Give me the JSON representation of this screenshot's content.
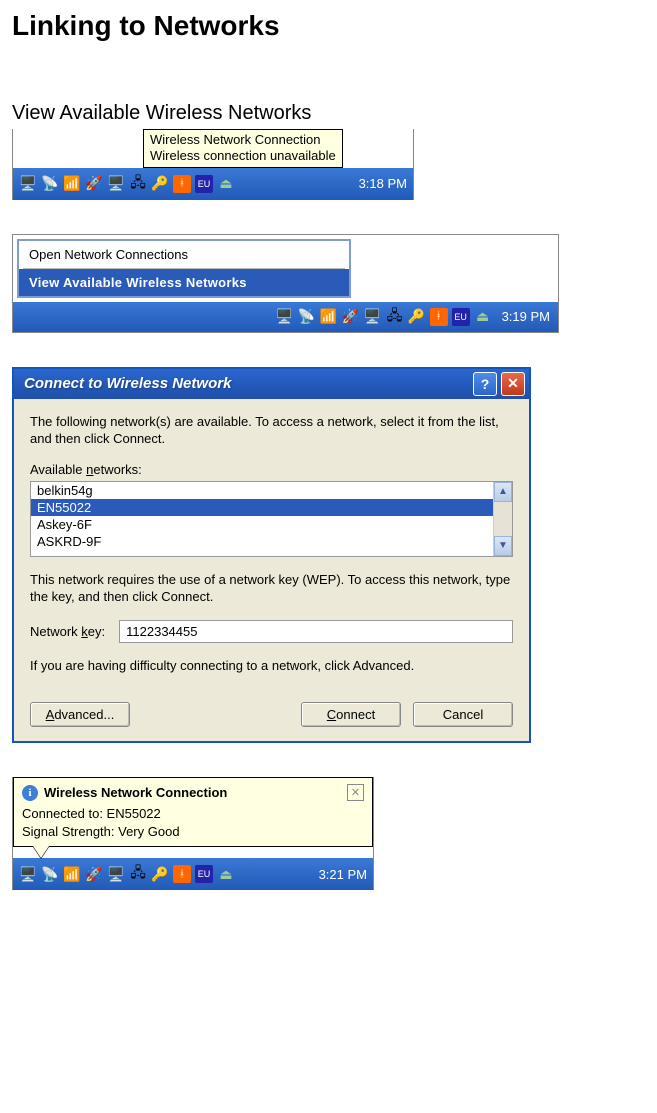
{
  "page": {
    "title": "Linking to Networks",
    "step_heading": "View Available Wireless Networks"
  },
  "shot1": {
    "tooltip_line1": "Wireless Network Connection",
    "tooltip_line2": "Wireless connection unavailable",
    "time": "3:18 PM"
  },
  "shot2": {
    "menu_open": "Open Network Connections",
    "menu_view": "View Available Wireless Networks",
    "time": "3:19 PM"
  },
  "dialog": {
    "title": "Connect to Wireless Network",
    "intro": "The following network(s) are available. To access a network, select it from the list, and then click Connect.",
    "available_label_pre": "Available ",
    "available_label_u": "n",
    "available_label_post": "etworks:",
    "networks": [
      "belkin54g",
      "EN55022",
      "Askey-6F",
      "ASKRD-9F"
    ],
    "wep_note": "This network requires the use of a network key (WEP). To access this network, type the key, and then click Connect.",
    "key_label_pre": "Network ",
    "key_label_u": "k",
    "key_label_post": "ey:",
    "key_value": "1122334455",
    "advanced_note": "If you are having difficulty connecting to a network, click Advanced.",
    "btn_advanced_u": "A",
    "btn_advanced_post": "dvanced...",
    "btn_connect_u": "C",
    "btn_connect_post": "onnect",
    "btn_cancel": "Cancel"
  },
  "shot4": {
    "title": "Wireless Network Connection",
    "line1": "Connected to: EN55022",
    "line2": "Signal Strength: Very Good",
    "time": "3:21 PM"
  },
  "icons": {
    "net": "network-icon",
    "vol": "volume-icon",
    "shield": "shield-icon",
    "bt": "bluetooth-icon"
  }
}
